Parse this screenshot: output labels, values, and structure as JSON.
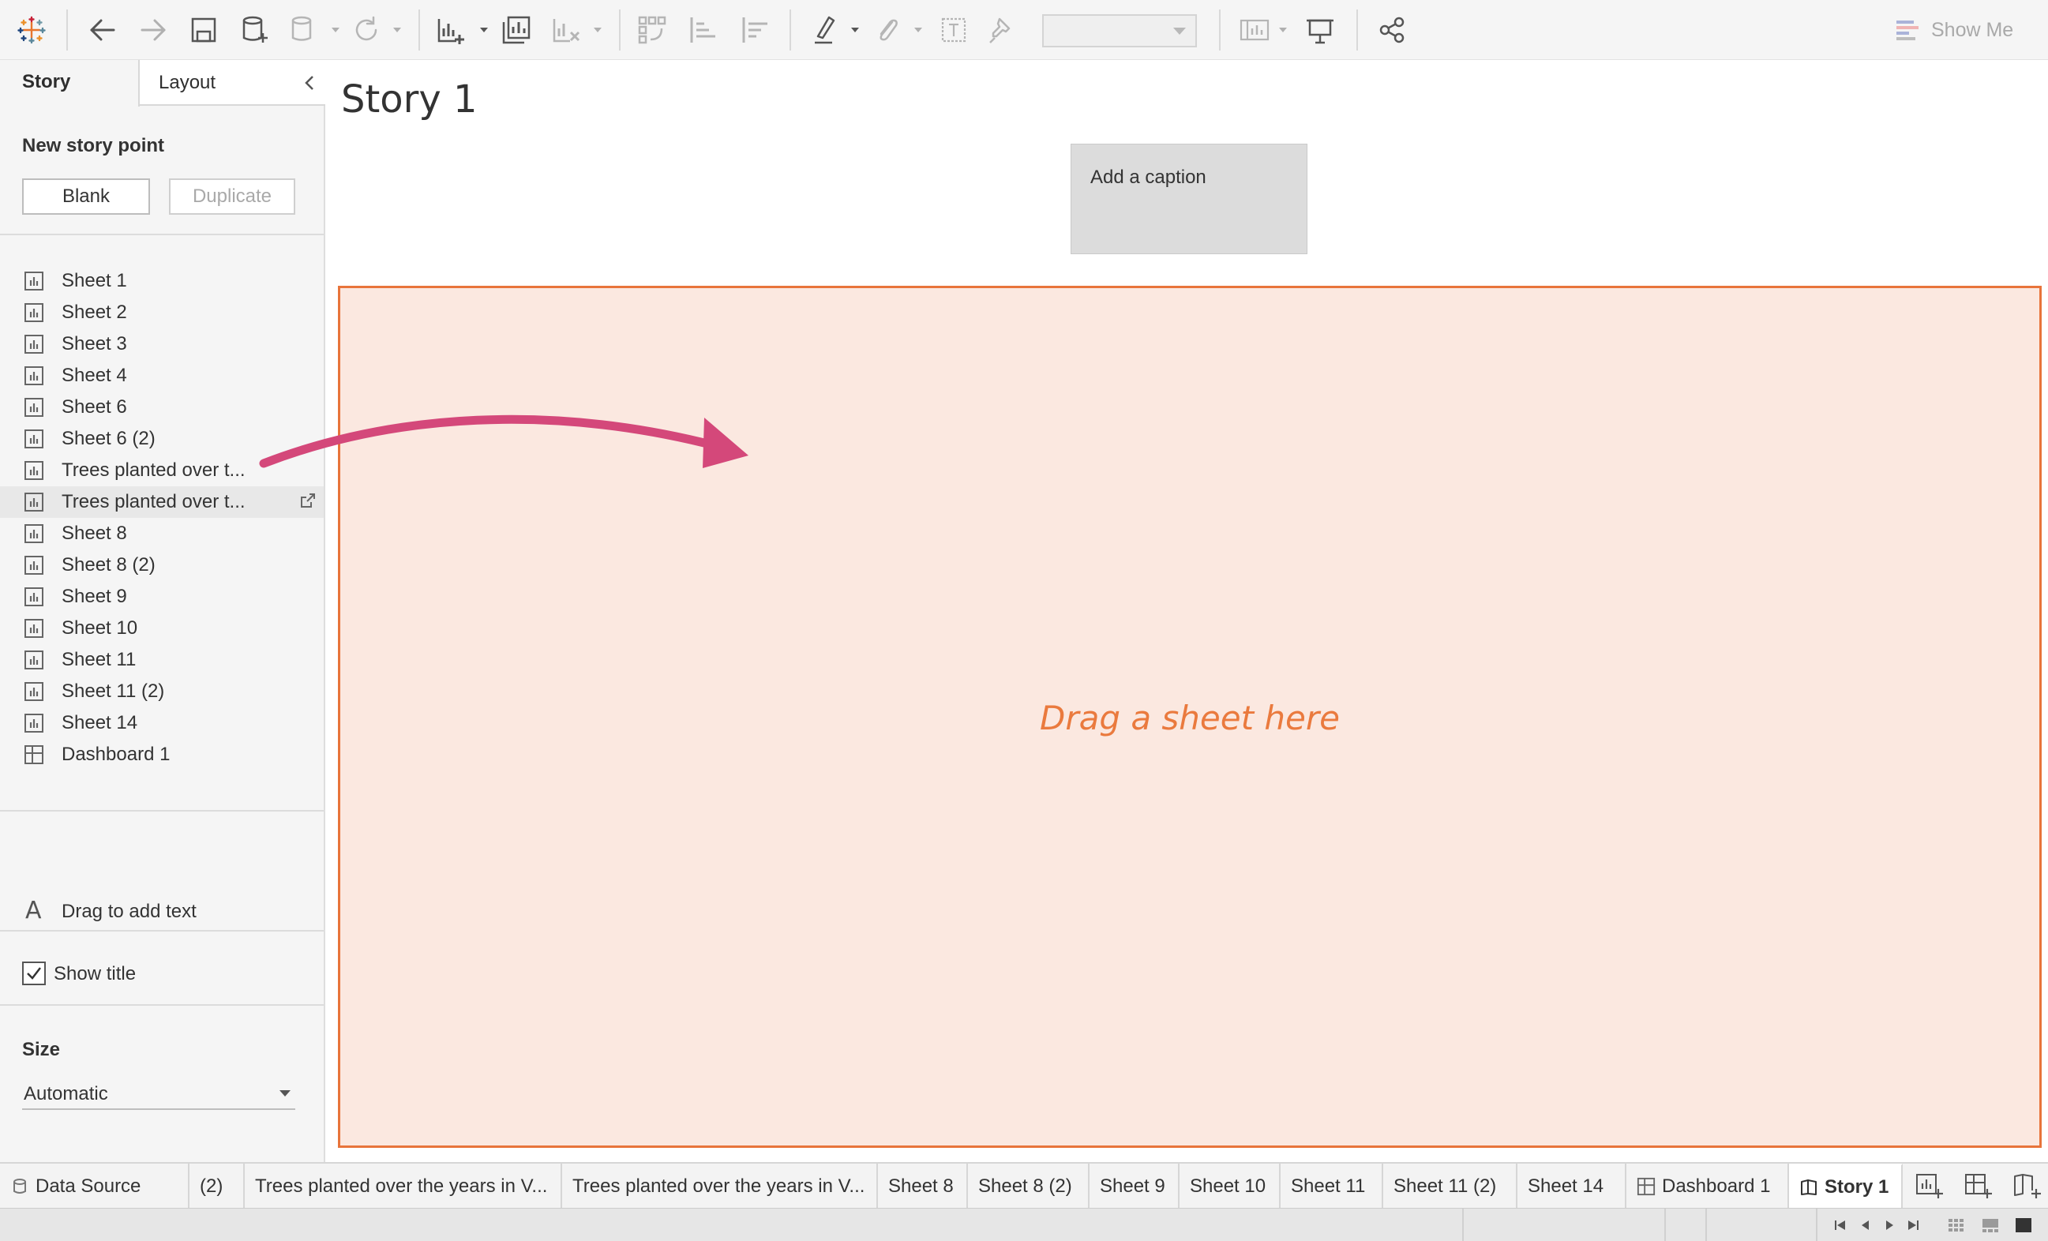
{
  "toolbar": {
    "icons": [
      "tableau-logo-icon",
      "undo-icon",
      "redo-icon",
      "save-icon",
      "new-data-source-icon",
      "pause-updates-icon",
      "refresh-icon",
      "new-worksheet-icon",
      "duplicate-sheet-icon",
      "clear-sheet-icon",
      "swap-rows-columns-icon",
      "sort-ascending-icon",
      "sort-descending-icon",
      "highlight-icon",
      "group-members-icon",
      "show-mark-labels-icon",
      "fix-axes-icon",
      "fit-icon",
      "show-cards-icon",
      "presentation-mode-icon",
      "share-icon"
    ],
    "fit_select_value": "",
    "show_me_label": "Show Me"
  },
  "left_pane": {
    "tabs": {
      "story": "Story",
      "layout": "Layout"
    },
    "new_story_point_heading": "New story point",
    "blank_button": "Blank",
    "duplicate_button": "Duplicate",
    "sheets": [
      {
        "label": "Sheet 1",
        "icon": "worksheet-icon"
      },
      {
        "label": "Sheet 2",
        "icon": "worksheet-icon"
      },
      {
        "label": "Sheet 3",
        "icon": "worksheet-icon"
      },
      {
        "label": "Sheet 4",
        "icon": "worksheet-icon"
      },
      {
        "label": "Sheet 6",
        "icon": "worksheet-icon"
      },
      {
        "label": "Sheet 6 (2)",
        "icon": "worksheet-icon"
      },
      {
        "label": "Trees planted over t...",
        "icon": "worksheet-icon"
      },
      {
        "label": "Trees planted over t...",
        "icon": "worksheet-icon",
        "selected": true
      },
      {
        "label": "Sheet 8",
        "icon": "worksheet-icon"
      },
      {
        "label": "Sheet 8 (2)",
        "icon": "worksheet-icon"
      },
      {
        "label": "Sheet 9",
        "icon": "worksheet-icon"
      },
      {
        "label": "Sheet 10",
        "icon": "worksheet-icon"
      },
      {
        "label": "Sheet 11",
        "icon": "worksheet-icon"
      },
      {
        "label": "Sheet 11 (2)",
        "icon": "worksheet-icon"
      },
      {
        "label": "Sheet 14",
        "icon": "worksheet-icon"
      },
      {
        "label": "Dashboard 1",
        "icon": "dashboard-icon"
      }
    ],
    "drag_to_add_text": "Drag to add text",
    "show_title_label": "Show title",
    "show_title_checked": true,
    "size_heading": "Size",
    "size_value": "Automatic"
  },
  "story": {
    "title": "Story 1",
    "caption": "Add a caption",
    "drop_placeholder": "Drag a sheet here"
  },
  "sheet_tabs": [
    {
      "label": "Data Source",
      "icon": "data-source-icon"
    },
    {
      "label": "(2)"
    },
    {
      "label": "Trees planted over the years in V..."
    },
    {
      "label": "Trees planted over the years in V..."
    },
    {
      "label": "Sheet 8"
    },
    {
      "label": "Sheet 8 (2)"
    },
    {
      "label": "Sheet 9"
    },
    {
      "label": "Sheet 10"
    },
    {
      "label": "Sheet 11"
    },
    {
      "label": "Sheet 11 (2)"
    },
    {
      "label": "Sheet 14"
    },
    {
      "label": "Dashboard 1",
      "icon": "dashboard-icon"
    },
    {
      "label": "Story 1",
      "icon": "story-icon",
      "active": true
    }
  ],
  "new_tab_icons": [
    "new-worksheet-icon",
    "new-dashboard-icon",
    "new-story-icon"
  ],
  "colors": {
    "accent_orange": "#e8743b",
    "drop_zone_fill": "#fbe8e0",
    "arrow_pink": "#d4487a"
  }
}
